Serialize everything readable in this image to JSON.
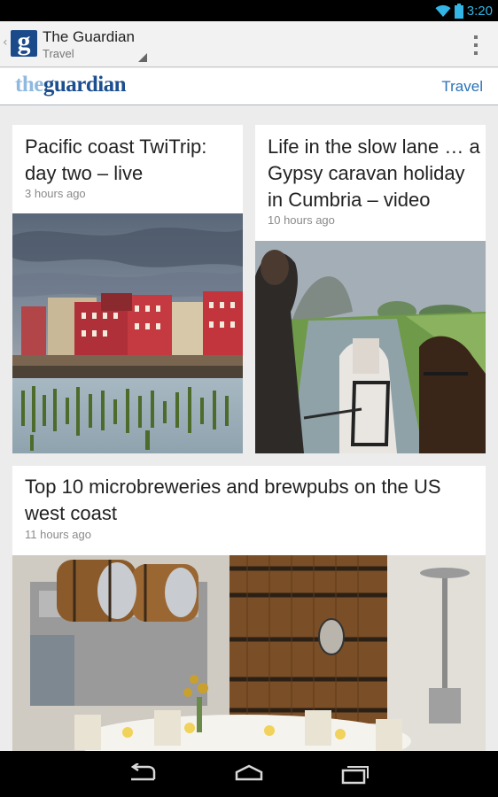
{
  "status_bar": {
    "time": "3:20",
    "icons": [
      "wifi-icon",
      "battery-icon"
    ],
    "accent_color": "#33b5e5"
  },
  "action_bar": {
    "up_caret": "‹",
    "logo_letter": "g",
    "title": "The Guardian",
    "subtitle": "Travel",
    "icons": [
      "guardian-app-icon",
      "spinner-arrow-icon",
      "overflow-menu-icon"
    ]
  },
  "section_header": {
    "wordmark_the": "the",
    "wordmark_guardian": "guardian",
    "section": "Travel"
  },
  "articles": [
    {
      "title": "Pacific coast TwiTrip: day two – live",
      "time": "3 hours ago",
      "image": "red waterfront buildings on pier with wooden pilings in water"
    },
    {
      "title": "Life in the slow lane … a Gypsy caravan holiday in Cumbria – video",
      "time": "10 hours ago",
      "image": "man driving horse-drawn caravan down a country lane"
    },
    {
      "title": "Top 10 microbreweries and brewpubs on the US west coast",
      "time": "11 hours ago",
      "image": "brewery interior with large wooden barrels and set dining table"
    }
  ],
  "nav_bar": {
    "icons": [
      "back-icon",
      "home-icon",
      "recent-apps-icon"
    ]
  }
}
